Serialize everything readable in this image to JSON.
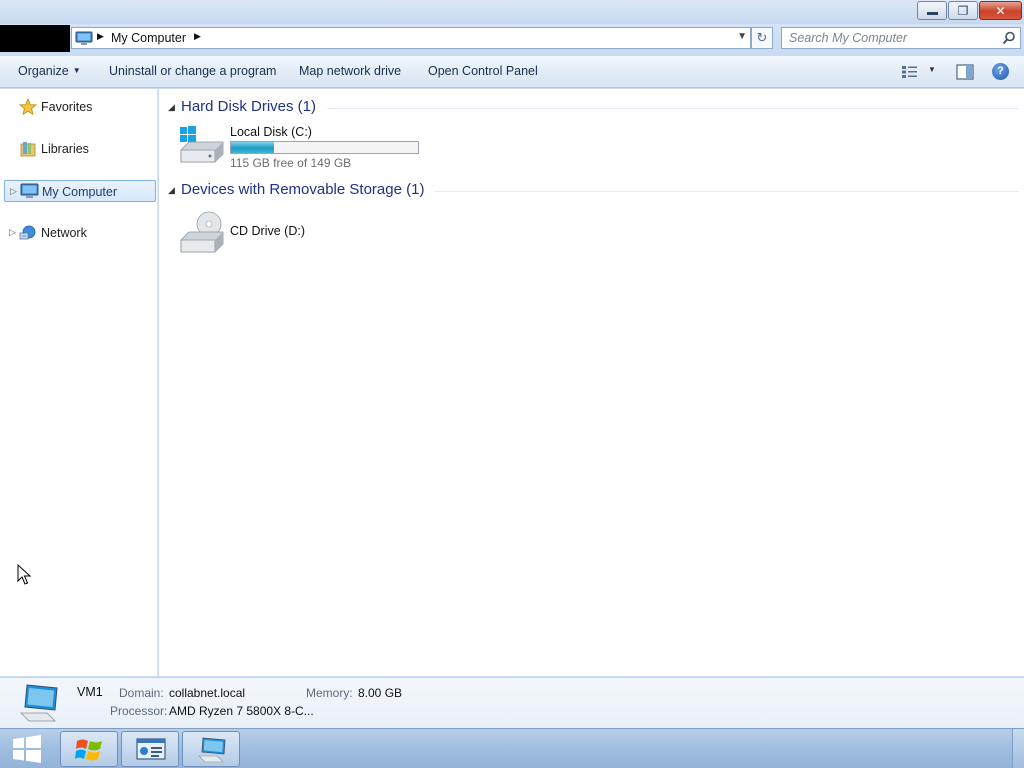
{
  "window": {
    "minimize_icon": "minimize-icon",
    "maximize_glyph": "❐",
    "close_glyph": "✕"
  },
  "address": {
    "breadcrumb": "My Computer",
    "refresh_glyph": "↻",
    "search_placeholder": "Search My Computer"
  },
  "toolbar": {
    "organize": "Organize",
    "uninstall": "Uninstall or change a program",
    "map_drive": "Map network drive",
    "control_panel": "Open Control Panel",
    "help_glyph": "?"
  },
  "sidebar": {
    "items": [
      {
        "label": "Favorites",
        "icon": "star-icon"
      },
      {
        "label": "Libraries",
        "icon": "libraries-icon"
      },
      {
        "label": "My Computer",
        "icon": "computer-icon",
        "selected": true
      },
      {
        "label": "Network",
        "icon": "network-icon"
      }
    ]
  },
  "content": {
    "groups": [
      {
        "title": "Hard Disk Drives (1)",
        "drives": [
          {
            "name": "Local Disk (C:)",
            "free_text": "115 GB free of 149 GB",
            "used_fraction": 0.228,
            "icon": "hard-disk-icon"
          }
        ]
      },
      {
        "title": "Devices with Removable Storage (1)",
        "drives": [
          {
            "name": "CD Drive (D:)",
            "icon": "cd-drive-icon"
          }
        ]
      }
    ]
  },
  "details": {
    "name": "VM1",
    "domain_label": "Domain:",
    "domain_value": "collabnet.local",
    "memory_label": "Memory:",
    "memory_value": "8.00 GB",
    "processor_label": "Processor:",
    "processor_value": "AMD Ryzen 7 5800X 8-C..."
  },
  "colors": {
    "accent": "#1e3287",
    "bar_fill": "#1b9cc4",
    "selection": "#d7e8fb"
  }
}
